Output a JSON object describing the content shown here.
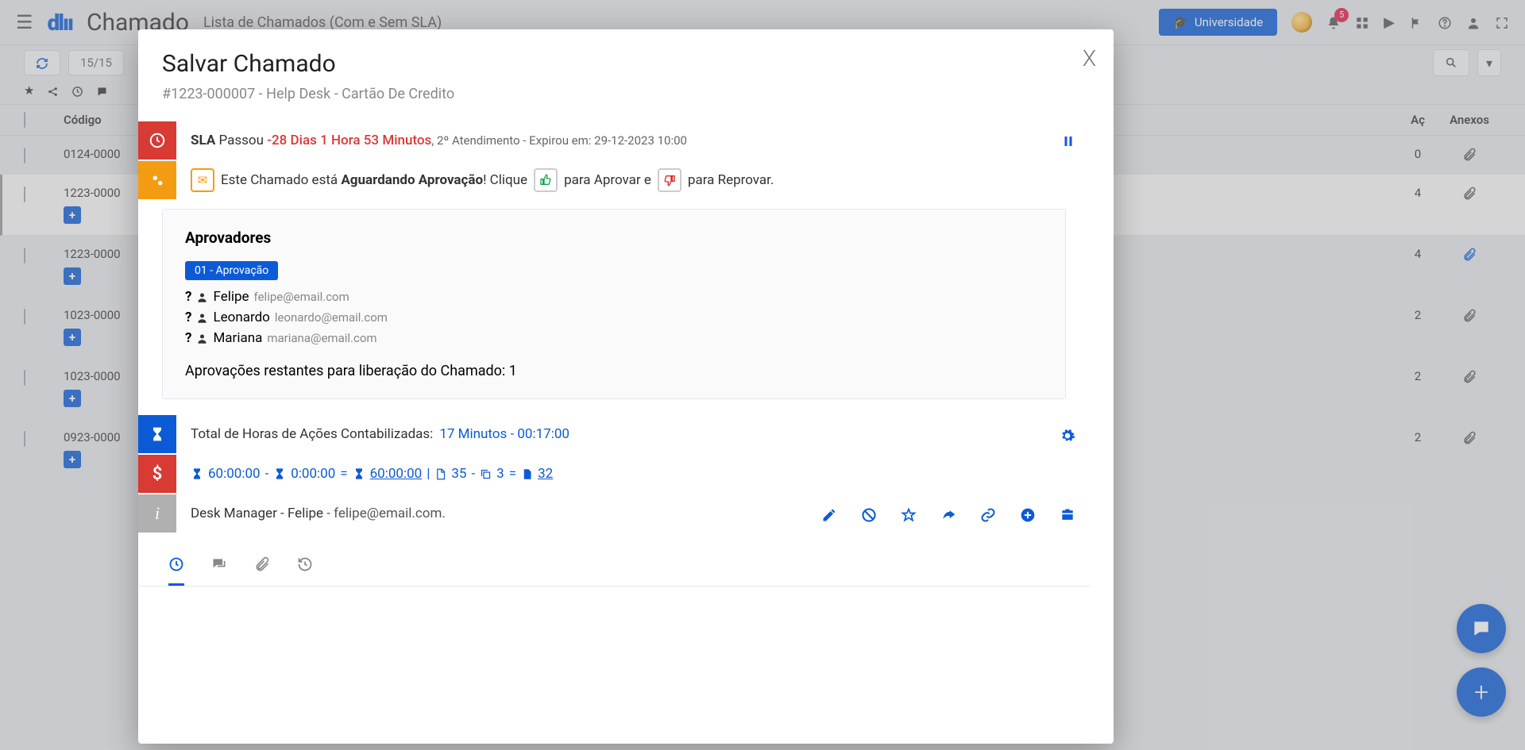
{
  "header": {
    "title_main": "Chamado",
    "title_sub": "Lista de Chamados (Com e Sem SLA)",
    "universidade_btn": "Universidade",
    "notification_count": "5"
  },
  "toolbar": {
    "count": "15/15"
  },
  "table": {
    "columns": {
      "codigo": "Código",
      "ac": "Aç",
      "anexos": "Anexos"
    },
    "rows": [
      {
        "code": "0124-0000",
        "plus": false,
        "ac": "0",
        "attach_blue": false
      },
      {
        "code": "1223-0000",
        "plus": true,
        "ac": "4",
        "attach_blue": false,
        "selected": true
      },
      {
        "code": "1223-0000",
        "plus": true,
        "ac": "4",
        "attach_blue": true
      },
      {
        "code": "1023-0000",
        "plus": true,
        "ac": "2",
        "attach_blue": false
      },
      {
        "code": "1023-0000",
        "plus": true,
        "ac": "2",
        "attach_blue": false
      },
      {
        "code": "0923-0000",
        "plus": true,
        "ac": "2",
        "attach_blue": false
      }
    ]
  },
  "modal": {
    "title": "Salvar Chamado",
    "subtitle": "#1223-000007 - Help Desk - Cartão De Credito",
    "sla": {
      "bold": "SLA",
      "passou": " Passou ",
      "time": "-28 Dias 1 Hora 53 Minutos",
      "tail": ", 2º Atendimento - Expirou em: 29-12-2023 10:00"
    },
    "approval_bar": {
      "l1": "Este Chamado está ",
      "bold": "Aguardando Aprovação",
      "l2": "! Clique ",
      "l3": " para Aprovar e ",
      "l4": " para Reprovar."
    },
    "approvers": {
      "title": "Aprovadores",
      "step": "01 - Aprovação",
      "list": [
        {
          "name": "Felipe",
          "mail": "felipe@email.com"
        },
        {
          "name": "Leonardo",
          "mail": "leonardo@email.com"
        },
        {
          "name": "Mariana",
          "mail": "mariana@email.com"
        }
      ],
      "remaining": "Aprovações restantes para liberação do Chamado: 1"
    },
    "hours": {
      "label": "Total de Horas de Ações Contabilizadas: ",
      "value": "17 Minutos - 00:17:00"
    },
    "cost": {
      "h1": "60:00:00",
      "dash1": " - ",
      "h2": "0:00:00",
      "eq": " = ",
      "h3": "60:00:00",
      "bar": " | ",
      "n1": "35",
      "dash2": " - ",
      "n2": "3",
      "eq2": " = ",
      "n3": "32"
    },
    "manager": {
      "text": "Desk Manager - Felipe",
      "email": " - felipe@email.com."
    }
  }
}
